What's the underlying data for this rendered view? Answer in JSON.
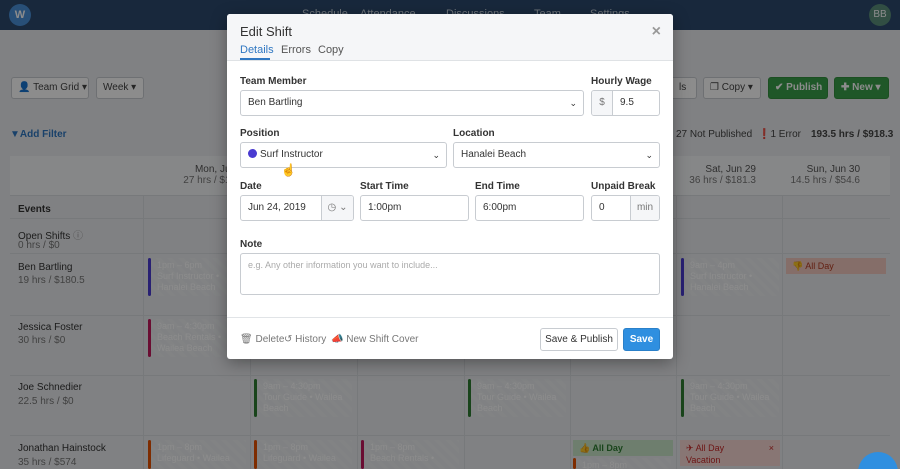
{
  "app": {
    "logo_letter": "W",
    "nav": [
      "Schedule",
      "Attendance",
      "Discussions",
      "Team",
      "Settings"
    ],
    "user_initials": "BB"
  },
  "toolbar": {
    "team_grid": "Team Grid",
    "week": "Week",
    "ls": "ls",
    "copy": "Copy",
    "publish": "Publish",
    "new": "New"
  },
  "filters": {
    "add_filter": "Add Filter",
    "not_published": "27 Not Published",
    "errors": "1 Error",
    "totals": "193.5 hrs / $918.3"
  },
  "grid": {
    "days": [
      {
        "label": "Mon, Jun 24",
        "sub": "27 hrs / $162.3"
      },
      {
        "label": "Sat, Jun 29",
        "sub": "36 hrs / $181.3"
      },
      {
        "label": "Sun, Jun 30",
        "sub": "14.5 hrs / $54.6"
      }
    ],
    "rows": [
      {
        "name": "Events",
        "sub": ""
      },
      {
        "name": "Open Shifts",
        "sub": "0 hrs / $0"
      },
      {
        "name": "Ben Bartling",
        "sub": "19 hrs / $180.5"
      },
      {
        "name": "Jessica Foster",
        "sub": "30 hrs / $0"
      },
      {
        "name": "Joe Schnedier",
        "sub": "22.5 hrs / $0"
      },
      {
        "name": "Jonathan Hainstock",
        "sub": "35 hrs / $574"
      }
    ],
    "shifts": [
      {
        "time": "1pm – 6pm",
        "role": "Surf Instructor •",
        "loc": "Hanalei Beach",
        "color": "#4a3bd1"
      },
      {
        "time": "9am – 4pm",
        "role": "Surf Instructor •",
        "loc": "Hanalei Beach",
        "color": "#4a3bd1"
      },
      {
        "time": "9am – 4:30pm",
        "role": "Beach Rentals •",
        "loc": "Wailea Beach",
        "color": "#c2185b"
      },
      {
        "time": "9am – 4:30pm",
        "role": "Tour Guide • Wailea",
        "loc": "Beach",
        "color": "#2e7d32"
      },
      {
        "time": "9am – 4:30pm",
        "role": "Tour Guide • Wailea",
        "loc": "Beach",
        "color": "#2e7d32"
      },
      {
        "time": "9am – 4:30pm",
        "role": "Tour Guide • Wailea",
        "loc": "Beach",
        "color": "#2e7d32"
      },
      {
        "time": "1pm – 8pm",
        "role": "Lifeguard • Wailea",
        "loc": "",
        "color": "#e65100"
      },
      {
        "time": "1pm – 8pm",
        "role": "Lifeguard • Wailea",
        "loc": "",
        "color": "#e65100"
      },
      {
        "time": "1pm – 8pm",
        "role": "Beach Rentals •",
        "loc": "",
        "color": "#c2185b"
      },
      {
        "time": "1pm – 8pm",
        "role": "",
        "loc": "",
        "color": "#e65100"
      }
    ],
    "all_day_1": "All Day",
    "all_day_2": "All Day",
    "all_day_3": "All Day",
    "vacation": "Vacation"
  },
  "modal": {
    "title": "Edit Shift",
    "tabs": [
      "Details",
      "Errors",
      "Copy"
    ],
    "labels": {
      "team_member": "Team Member",
      "hourly_wage": "Hourly Wage",
      "position": "Position",
      "location": "Location",
      "date": "Date",
      "start_time": "Start Time",
      "end_time": "End Time",
      "unpaid_break": "Unpaid Break",
      "note": "Note"
    },
    "values": {
      "team_member": "Ben Bartling",
      "currency": "$",
      "hourly_wage": "9.5",
      "position": "Surf Instructor",
      "location": "Hanalei Beach",
      "date": "Jun 24, 2019",
      "start_time": "1:00pm",
      "end_time": "6:00pm",
      "unpaid_break": "0",
      "break_unit": "min"
    },
    "note_placeholder": "e.g. Any other information you want to include...",
    "footer": {
      "delete": "Delete",
      "history": "History",
      "new_shift_cover": "New Shift Cover",
      "save_publish": "Save & Publish",
      "save": "Save"
    },
    "colors": {
      "accent": "#2f8fe0",
      "position_dot": "#4a3bd1"
    }
  }
}
